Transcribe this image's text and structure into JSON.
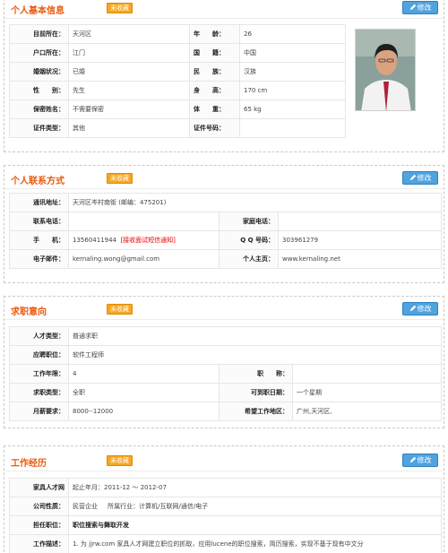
{
  "basic": {
    "title": "个人基本信息",
    "tag": "未收藏",
    "edit": "修改",
    "rows": [
      [
        "目前所在：",
        "天河区",
        "年　　龄：",
        "26"
      ],
      [
        "户口所在：",
        "江门",
        "国　　籍：",
        "中国"
      ],
      [
        "婚姻状况：",
        "已婚",
        "民　　族：",
        "汉族"
      ],
      [
        "性　　别：",
        "先生",
        "身　　高：",
        "170 cm"
      ],
      [
        "保密姓名：",
        "不需要保密",
        "体　　重：",
        "65 kg"
      ],
      [
        "证件类型：",
        "其他",
        "证件号码：",
        ""
      ]
    ]
  },
  "contact": {
    "title": "个人联系方式",
    "tag": "未收藏",
    "edit": "修改",
    "address_label": "通讯地址：",
    "address_value": "天河区岑村南街 (邮编：475201)",
    "phone_label": "联系电话：",
    "phone_value": "",
    "home_phone_label": "家庭电话：",
    "home_phone_value": "",
    "mobile_label": "手　　机：",
    "mobile_value": "13560411944",
    "mobile_notice": "[接收面试短信通知]",
    "qq_label": "Q Q 号码：",
    "qq_value": "303961279",
    "email_label": "电子邮件：",
    "email_value": "kernaling.wong@gmail.com",
    "homepage_label": "个人主页：",
    "homepage_value": "www.kernaling.net"
  },
  "intention": {
    "title": "求职意向",
    "tag": "未收藏",
    "edit": "修改",
    "type_label": "人才类型：",
    "type_value": "普通求职",
    "position_label": "应聘职位：",
    "position_value": "软件工程师",
    "years_label": "工作年限：",
    "years_value": "4",
    "title_label": "职　　称：",
    "title_value": "",
    "nature_label": "求职类型：",
    "nature_value": "全职",
    "available_label": "可到职日期：",
    "available_value": "一个星期",
    "salary_label": "月薪要求：",
    "salary_value": "8000--12000",
    "area_label": "希望工作地区：",
    "area_value": "广州,天河区,"
  },
  "experience": {
    "title": "工作经历",
    "tag": "未收藏",
    "edit": "修改",
    "company": "家具人才网",
    "period": "起止年月：2011-12 ～ 2012-07",
    "nature_label": "公司性质：",
    "nature_value": "民营企业",
    "industry": "所属行业：计算机/互联网/通信/电子",
    "role_label": "担任职位：",
    "role_value": "职位搜索与舞取开发",
    "desc_label": "工作描述：",
    "desc_value": "1. 为 jjrw.com 家具人才网建立职位的抓取，应用lucene的职位搜索，简历搜索，实现不基于现有中文分"
  },
  "colors": {
    "accent": "#e8590c",
    "tag": "#f5a623",
    "edit": "#4fa3df"
  }
}
